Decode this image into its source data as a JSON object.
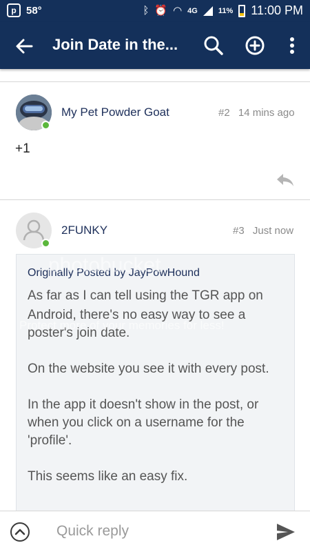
{
  "status_bar": {
    "temperature": "58°",
    "network": "4G",
    "battery": "11%",
    "time": "11:00 PM"
  },
  "app_bar": {
    "title": "Join Date in the..."
  },
  "posts": [
    {
      "username": "My Pet Powder Goat",
      "number": "#2",
      "time": "14 mins ago",
      "body": "+1"
    },
    {
      "username": "2FUNKY",
      "number": "#3",
      "time": "Just now",
      "quote": {
        "header": "Originally Posted by JayPowHound",
        "lines": [
          "As far as I can tell using the TGR app on",
          "Android, there's no easy way to see a",
          "poster's join date.",
          "",
          "On the website you see it with every post.",
          "",
          "In the app it doesn't show in the post, or",
          "when you click on a username for the",
          "'profile'.",
          "",
          "This seems like an easy fix."
        ]
      }
    }
  ],
  "watermark": {
    "brand": "photobucket",
    "tagline": "Protect more of your memories for less!"
  },
  "composer": {
    "placeholder": "Quick reply"
  },
  "colors": {
    "appbar": "#14305a",
    "online": "#5bb73c",
    "username": "#1d2f5a"
  }
}
